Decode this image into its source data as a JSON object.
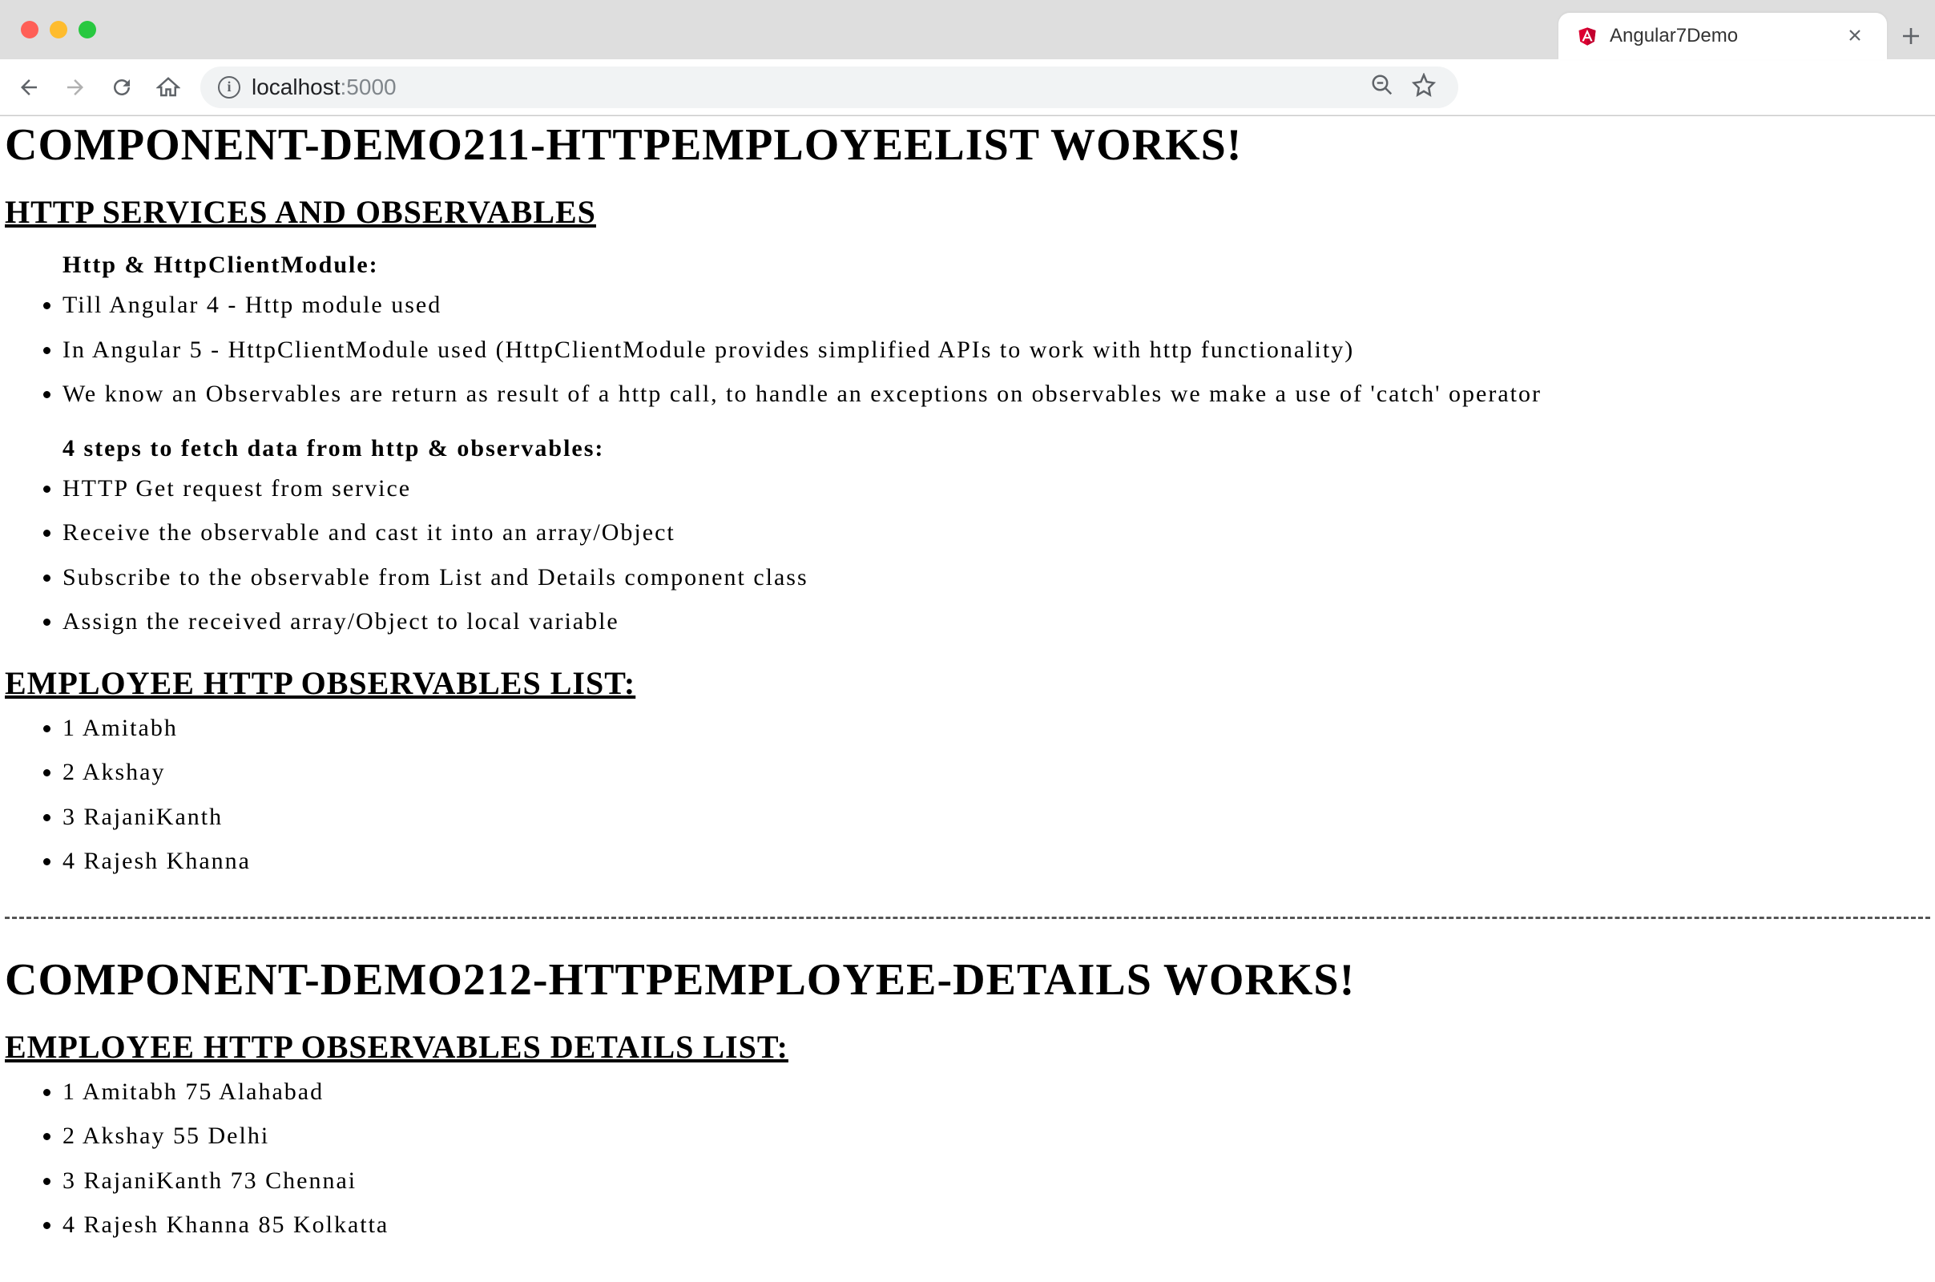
{
  "browser": {
    "tab_title": "Angular7Demo",
    "url_host": "localhost",
    "url_port": ":5000"
  },
  "page": {
    "h1_a": "COMPONENT-DEMO211-HTTPEMPLOYEELIST WORKS!",
    "h2_a": "HTTP SERVICES AND OBSERVABLES",
    "sub_a": "Http & HttpClientModule:",
    "list_a": [
      "Till Angular 4 - Http module used",
      "In Angular 5 - HttpClientModule used (HttpClientModule provides simplified APIs to work with http functionality)",
      "We know an Observables are return as result of a http call, to handle an exceptions on observables we make a use of 'catch' operator"
    ],
    "sub_b": "4 steps to fetch data from http & observables:",
    "list_b": [
      "HTTP Get request from service",
      "Receive the observable and cast it into an array/Object",
      "Subscribe to the observable from List and Details component class",
      "Assign the received array/Object to local variable"
    ],
    "h2_b": "EMPLOYEE HTTP OBSERVABLES LIST:",
    "emp_list": [
      "1 Amitabh",
      "2 Akshay",
      "3 RajaniKanth",
      "4 Rajesh Khanna"
    ],
    "h1_b": "COMPONENT-DEMO212-HTTPEMPLOYEE-DETAILS WORKS!",
    "h2_c": "EMPLOYEE HTTP OBSERVABLES DETAILS LIST:",
    "emp_details": [
      "1 Amitabh 75 Alahabad",
      "2 Akshay 55 Delhi",
      "3 RajaniKanth 73 Chennai",
      "4 Rajesh Khanna 85 Kolkatta"
    ]
  }
}
